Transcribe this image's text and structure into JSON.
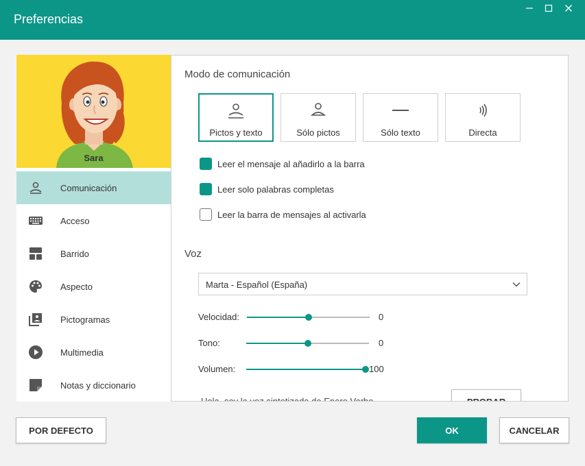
{
  "window": {
    "title": "Preferencias"
  },
  "profile": {
    "name": "Sara"
  },
  "sidebar": {
    "items": [
      {
        "label": "Comunicación",
        "icon": "person-icon",
        "active": true
      },
      {
        "label": "Acceso",
        "icon": "keyboard-icon",
        "active": false
      },
      {
        "label": "Barrido",
        "icon": "scan-icon",
        "active": false
      },
      {
        "label": "Aspecto",
        "icon": "palette-icon",
        "active": false
      },
      {
        "label": "Pictogramas",
        "icon": "pictograms-icon",
        "active": false
      },
      {
        "label": "Multimedia",
        "icon": "play-icon",
        "active": false
      },
      {
        "label": "Notas y diccionario",
        "icon": "note-icon",
        "active": false
      }
    ]
  },
  "communication": {
    "title": "Modo de comunicación",
    "modes": [
      {
        "label": "Pictos y texto",
        "icon": "person-text-icon",
        "selected": true
      },
      {
        "label": "Sólo pictos",
        "icon": "person-icon",
        "selected": false
      },
      {
        "label": "Sólo texto",
        "icon": "text-line-icon",
        "selected": false
      },
      {
        "label": "Directa",
        "icon": "speech-waves-icon",
        "selected": false
      }
    ],
    "options": [
      {
        "label": "Leer el mensaje al añadirlo a la barra",
        "checked": true
      },
      {
        "label": "Leer solo palabras completas",
        "checked": true
      },
      {
        "label": "Leer la barra de mensajes al activarla",
        "checked": false
      }
    ]
  },
  "voice": {
    "title": "Voz",
    "selected_voice": "Marta - Español (España)",
    "sliders": [
      {
        "label": "Velocidad:",
        "value": "0",
        "fraction": 0.5
      },
      {
        "label": "Tono:",
        "value": "0",
        "fraction": 0.5
      },
      {
        "label": "Volumen:",
        "value": "100",
        "fraction": 1.0
      }
    ],
    "test_text": "Hola, soy la voz sintetizada de Enero Verbo",
    "test_button": "PROBAR"
  },
  "footer": {
    "default_button": "POR DEFECTO",
    "ok_button": "OK",
    "cancel_button": "CANCELAR"
  },
  "colors": {
    "accent": "#0c9688",
    "active_nav": "#b3dfdb",
    "avatar_bg": "#fbd832"
  }
}
